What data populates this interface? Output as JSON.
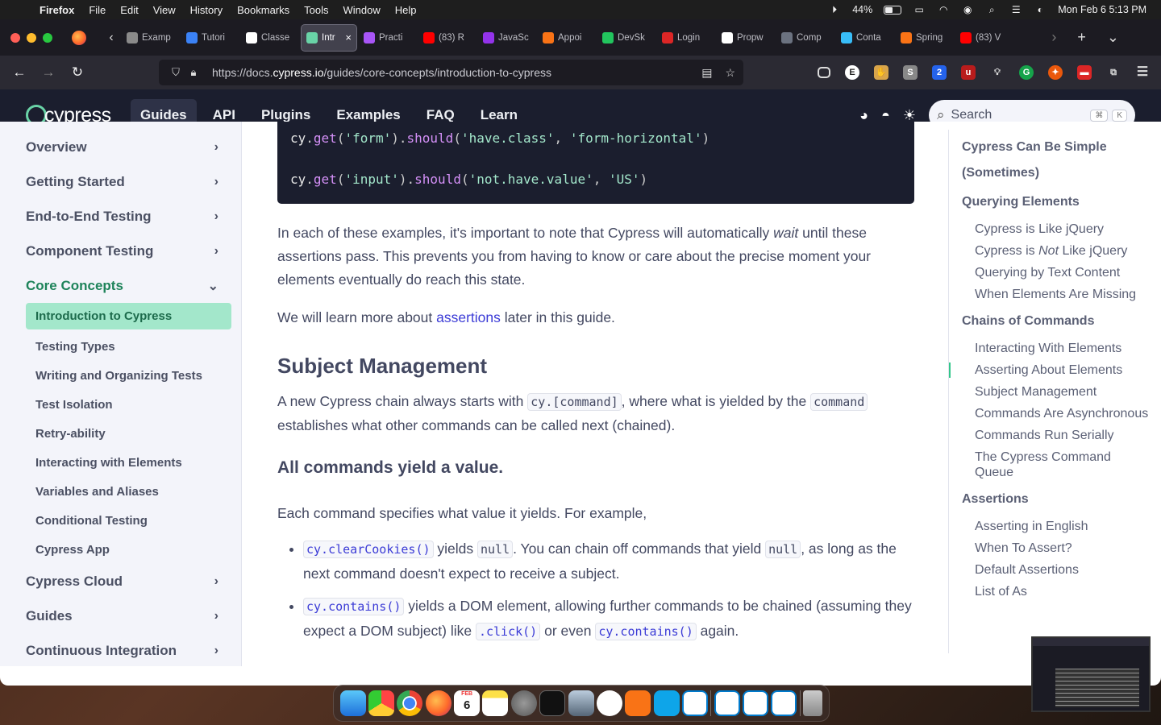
{
  "menubar": {
    "app": "Firefox",
    "items": [
      "File",
      "Edit",
      "View",
      "History",
      "Bookmarks",
      "Tools",
      "Window",
      "Help"
    ],
    "battery": "44%",
    "datetime": "Mon Feb 6  5:13 PM"
  },
  "tabs": [
    {
      "label": "Examp",
      "color": "#8a8a8a"
    },
    {
      "label": "Tutori",
      "color": "#3b82f6"
    },
    {
      "label": "Classe",
      "color": "#ffffff"
    },
    {
      "label": "Intr",
      "color": "#69d3a7",
      "active": true
    },
    {
      "label": "Practi",
      "color": "#a855f7"
    },
    {
      "label": "(83) R",
      "color": "#ff0000"
    },
    {
      "label": "JavaSc",
      "color": "#9333ea"
    },
    {
      "label": "Appoi",
      "color": "#f97316"
    },
    {
      "label": "DevSk",
      "color": "#22c55e"
    },
    {
      "label": "Login",
      "color": "#dc2626"
    },
    {
      "label": "Propw",
      "color": "#ffffff"
    },
    {
      "label": "Comp",
      "color": "#6b7280"
    },
    {
      "label": "Conta",
      "color": "#38bdf8"
    },
    {
      "label": "Spring",
      "color": "#f97316"
    },
    {
      "label": "(83) V",
      "color": "#ff0000"
    }
  ],
  "url": {
    "prefix": "https://docs.",
    "domain": "cypress.io",
    "path": "/guides/core-concepts/introduction-to-cypress"
  },
  "site": {
    "logo": "cypress",
    "nav": [
      "Guides",
      "API",
      "Plugins",
      "Examples",
      "FAQ",
      "Learn"
    ],
    "active_nav": "Guides",
    "search_placeholder": "Search",
    "search_keys": [
      "⌘",
      "K"
    ]
  },
  "sidebar": {
    "sections": [
      "Overview",
      "Getting Started",
      "End-to-End Testing",
      "Component Testing",
      "Core Concepts"
    ],
    "sub_items": [
      "Introduction to Cypress",
      "Testing Types",
      "Writing and Organizing Tests",
      "Test Isolation",
      "Retry-ability",
      "Interacting with Elements",
      "Variables and Aliases",
      "Conditional Testing",
      "Cypress App"
    ],
    "sections_after": [
      "Cypress Cloud",
      "Guides",
      "Continuous Integration"
    ]
  },
  "code": {
    "l1": {
      "obj": "cy",
      "fn1": "get",
      "arg1": "'form'",
      "fn2": "should",
      "arg2": "'have.class'",
      "arg3": "'form-horizontal'"
    },
    "l2": {
      "obj": "cy",
      "fn1": "get",
      "arg1": "'input'",
      "fn2": "should",
      "arg2": "'not.have.value'",
      "arg3": "'US'"
    }
  },
  "article": {
    "p1_a": "In each of these examples, it's important to note that Cypress will automatically ",
    "p1_em": "wait",
    "p1_b": " until these assertions pass. This prevents you from having to know or care about the precise moment your elements eventually do reach this state.",
    "p2_a": "We will learn more about ",
    "p2_link": "assertions",
    "p2_b": " later in this guide.",
    "h2": "Subject Management",
    "p3_a": "A new Cypress chain always starts with ",
    "p3_code1": "cy.[command]",
    "p3_b": ", where what is yielded by the ",
    "p3_code2": "command",
    "p3_c": " establishes what other commands can be called next (chained).",
    "h3": "All commands yield a value.",
    "p4": "Each command specifies what value it yields. For example,",
    "b1_code": "cy.clearCookies()",
    "b1_a": " yields ",
    "b1_null": "null",
    "b1_b": ". You can chain off commands that yield ",
    "b1_null2": "null",
    "b1_c": ", as long as the next command doesn't expect to receive a subject.",
    "b2_code": "cy.contains()",
    "b2_a": " yields a DOM element, allowing further commands to be chained (assuming they expect a DOM subject) like ",
    "b2_code2": ".click()",
    "b2_b": " or even ",
    "b2_code3": "cy.contains()",
    "b2_c": " again."
  },
  "toc": {
    "h1": "Cypress Can Be Simple (Sometimes)",
    "h2": "Querying Elements",
    "q_items": [
      "Cypress is Like jQuery"
    ],
    "q_not_a": "Cypress is ",
    "q_not_em": "Not",
    "q_not_b": " Like jQuery",
    "q_items2": [
      "Querying by Text Content",
      "When Elements Are Missing"
    ],
    "h3": "Chains of Commands",
    "c_items": [
      "Interacting With Elements",
      "Asserting About Elements",
      "Subject Management",
      "Commands Are Asynchronous",
      "Commands Run Serially",
      "The Cypress Command Queue"
    ],
    "h4": "Assertions",
    "a_items": [
      "Asserting in English",
      "When To Assert?",
      "Default Assertions",
      "List of As"
    ]
  },
  "dock": {
    "calendar_day": "6",
    "calendar_month": "FEB"
  }
}
